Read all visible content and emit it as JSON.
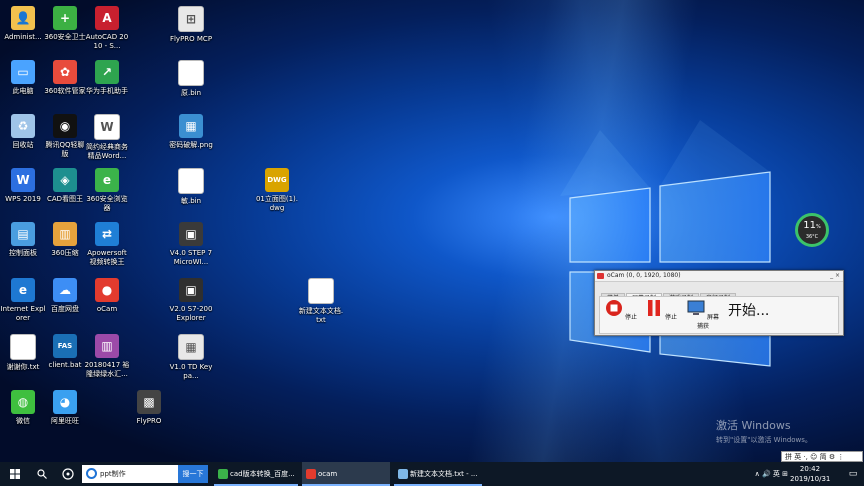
{
  "desktop_icons": [
    {
      "label": "Administ...",
      "icon": "user-folder-icon",
      "color": "#f2c14e"
    },
    {
      "label": "360安全卫士",
      "icon": "360-security-icon",
      "color": "#3cb043"
    },
    {
      "label": "AutoCAD 2010 - S...",
      "icon": "autocad-icon",
      "color": "#c8202f"
    },
    {
      "label": "FlyPRO MCP",
      "icon": "network-icon",
      "color": "#e8e8e8"
    },
    {
      "label": "此电脑",
      "icon": "computer-icon",
      "color": "#4aa3ff"
    },
    {
      "label": "360软件管家",
      "icon": "360-software-icon",
      "color": "#e84b3c"
    },
    {
      "label": "华为手机助手",
      "icon": "huawei-assistant-icon",
      "color": "#2ea44f"
    },
    {
      "label": "原.bin",
      "icon": "file-icon",
      "color": "#ffffff"
    },
    {
      "label": "回收站",
      "icon": "recycle-bin-icon",
      "color": "#9fc4e8"
    },
    {
      "label": "腾讯QQ轻聊版",
      "icon": "qq-icon",
      "color": "#111111"
    },
    {
      "label": "简约经典商务精品Word...",
      "icon": "word-doc-icon",
      "color": "#ffffff"
    },
    {
      "label": "密码破解.png",
      "icon": "image-icon",
      "color": "#3b8fd1"
    },
    {
      "label": "WPS 2019",
      "icon": "wps-icon",
      "color": "#2c6fe0"
    },
    {
      "label": "CAD看图王",
      "icon": "cad-viewer-icon",
      "color": "#1d8f8f"
    },
    {
      "label": "360安全浏览器",
      "icon": "360-browser-icon",
      "color": "#3bb34a"
    },
    {
      "label": "敏.bin",
      "icon": "file-icon",
      "color": "#ffffff"
    },
    {
      "label": "01立面图(1).dwg",
      "icon": "dwg-file-icon",
      "color": "#d9a400"
    },
    {
      "label": "控制面板",
      "icon": "control-panel-icon",
      "color": "#4a9de0"
    },
    {
      "label": "360压缩",
      "icon": "360-zip-icon",
      "color": "#e6a23c"
    },
    {
      "label": "Apowersoft视频转换王",
      "icon": "video-converter-icon",
      "color": "#1f7fd6"
    },
    {
      "label": "V4.0 STEP 7 MicroWI...",
      "icon": "step7-icon",
      "color": "#3a3a3a"
    },
    {
      "label": "Internet Explorer",
      "icon": "ie-icon",
      "color": "#1e78d2"
    },
    {
      "label": "百度网盘",
      "icon": "baidu-netdisk-icon",
      "color": "#3d8ef5"
    },
    {
      "label": "oCam",
      "icon": "ocam-icon",
      "color": "#e23b2e"
    },
    {
      "label": "V2.0 S7-200 Explorer",
      "icon": "s7-explorer-icon",
      "color": "#2f2f2f"
    },
    {
      "label": "新建文本文档.txt",
      "icon": "text-file-icon",
      "color": "#ffffff"
    },
    {
      "label": "谢谢你.txt",
      "icon": "text-file-icon",
      "color": "#ffffff"
    },
    {
      "label": "client.bat",
      "icon": "bat-file-icon",
      "color": "#1a6fb5"
    },
    {
      "label": "20180417 裕隆绿绿水汇...",
      "icon": "rar-icon",
      "color": "#9c4aa8"
    },
    {
      "label": "V1.0 TD Keypa...",
      "icon": "keypad-icon",
      "color": "#e8e8e8"
    },
    {
      "label": "微信",
      "icon": "wechat-icon",
      "color": "#3fbf3f"
    },
    {
      "label": "阿里旺旺",
      "icon": "aliwangwang-icon",
      "color": "#3aa0f0"
    },
    {
      "label": "FlyPRO",
      "icon": "chip-icon",
      "color": "#444444"
    }
  ],
  "ocam": {
    "title": "oCam (0, 0, 1920, 1080)",
    "tabs": [
      "菜单",
      "屏幕录制",
      "游戏录制",
      "音频录制"
    ],
    "active_tab": "屏幕录制",
    "buttons": [
      "停止",
      "停止",
      "屏幕捕获"
    ],
    "status": "开始...",
    "window_controls": "_ ×"
  },
  "gauge": {
    "percent": "11",
    "unit": "%",
    "temp": "36°C",
    "color": "#3cc36a"
  },
  "watermark": {
    "line1": "激活 Windows",
    "line2": "转到\"设置\"以激活 Windows。"
  },
  "ime_bar": "拼 英 ·, ☺ 简 ⚙ ⋮",
  "taskbar": {
    "search_text": "ppt制作",
    "search_button": "搜一下",
    "tasks": [
      {
        "label": "cad版本转换_百度...",
        "icon": "360-browser-icon",
        "color": "#3bb34a"
      },
      {
        "label": "ocam",
        "icon": "ocam-icon",
        "color": "#e23b2e"
      },
      {
        "label": "新建文本文档.txt - ...",
        "icon": "notepad-icon",
        "color": "#7fb8e8"
      }
    ],
    "tray": "∧ 🔊 英 ⊞",
    "time": "20:42",
    "date": "2019/10/31"
  }
}
